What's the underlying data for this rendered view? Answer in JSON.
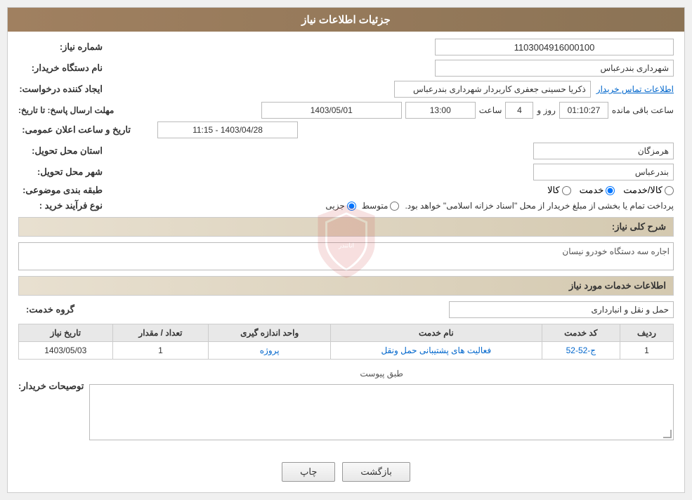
{
  "header": {
    "title": "جزئیات اطلاعات نیاز"
  },
  "fields": {
    "shomareNiaz_label": "شماره نیاز:",
    "shomareNiaz_value": "1103004916000100",
    "namDastgah_label": "نام دستگاه خریدار:",
    "namDastgah_value": "شهرداری بندرعباس",
    "ijadKonande_label": "ایجاد کننده درخواست:",
    "ijadKonande_value": "ذکریا حسینی جعفری کاربردار شهرداری بندرعباس",
    "ettelaat_link": "اطلاعات تماس خریدار",
    "mohlatErssal_label": "مهلت ارسال پاسخ: تا تاریخ:",
    "date_value": "1403/05/01",
    "saat_label": "ساعت",
    "saat_value": "13:00",
    "rooz_label": "روز و",
    "rooz_value": "4",
    "mandeh_label": "ساعت باقی مانده",
    "timer_value": "01:10:27",
    "tarikh_label": "تاریخ و ساعت اعلان عمومی:",
    "tarikh_value": "1403/04/28 - 11:15",
    "ostan_label": "استان محل تحویل:",
    "ostan_value": "هرمزگان",
    "shahr_label": "شهر محل تحویل:",
    "shahr_value": "بندرعباس",
    "tabaqeBandi_label": "طبقه بندی موضوعی:",
    "radio1": "کالا",
    "radio2": "خدمت",
    "radio3": "کالا/خدمت",
    "radio1_selected": false,
    "radio2_selected": true,
    "radio3_selected": false,
    "noFarayand_label": "نوع فرآیند خرید :",
    "radio_jozyi": "جزیی",
    "radio_motavaset": "متوسط",
    "process_desc": "پرداخت تمام یا بخشی از مبلغ خریدار از محل \"اسناد خزانه اسلامی\" خواهد بود.",
    "sharhKoli_label": "شرح کلی نیاز:",
    "sharhKoli_value": "اجاره سه دستگاه خودرو نیسان",
    "khadamat_label": "اطلاعات خدمات مورد نیاز",
    "grooh_label": "گروه خدمت:",
    "grooh_value": "حمل و نقل و انبارداری",
    "table_headers": [
      "ردیف",
      "کد خدمت",
      "نام خدمت",
      "واحد اندازه گیری",
      "تعداد / مقدار",
      "تاریخ نیاز"
    ],
    "table_rows": [
      {
        "radif": "1",
        "kod": "ج-52-52",
        "name": "فعالیت های پشتیبانی حمل ونقل",
        "vahed": "پروژه",
        "tedad": "1",
        "tarikh": "1403/05/03"
      }
    ],
    "tosihBuyerAttach_label": "طبق پیوست",
    "tosih_label": "توصیحات خریدار:"
  },
  "buttons": {
    "print": "چاپ",
    "back": "بازگشت"
  }
}
